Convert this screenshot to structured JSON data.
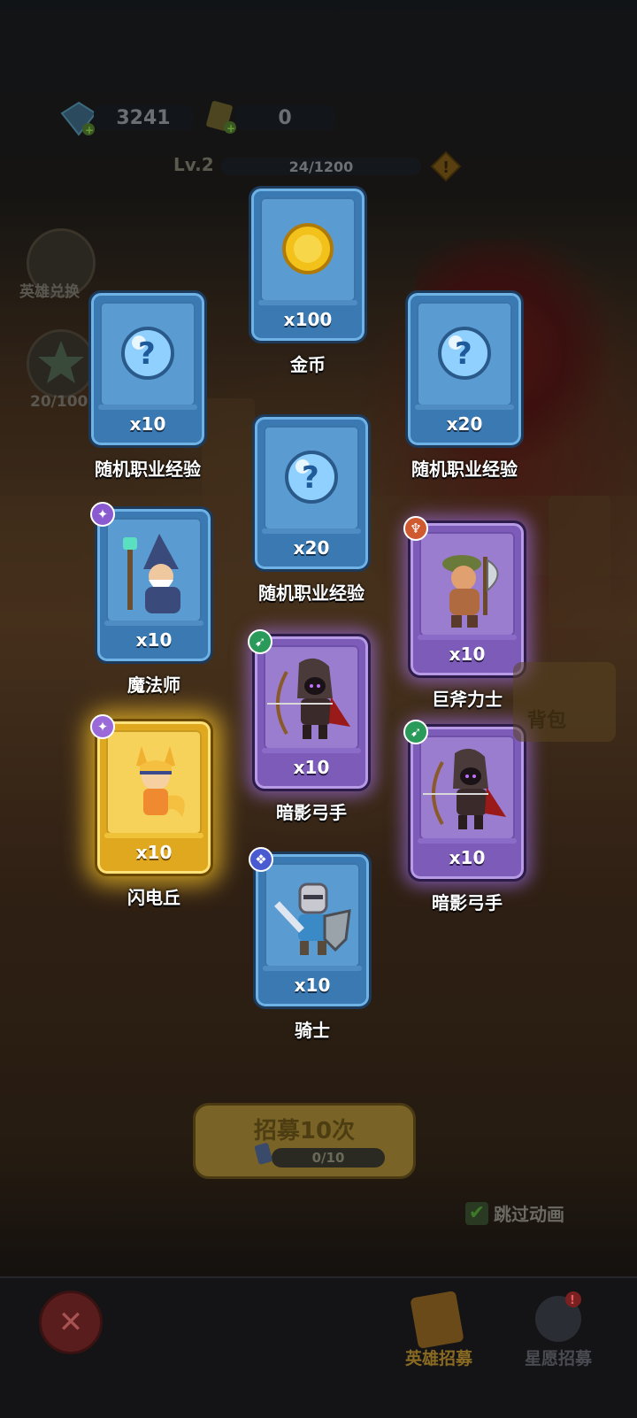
{
  "currency": {
    "gems": "3241",
    "tickets": "0"
  },
  "level": {
    "label": "Lv.2",
    "progress_text": "24/1200",
    "progress_fraction": 0.02
  },
  "side": {
    "exchange_label": "英雄兑换",
    "star_count": "20/100"
  },
  "rewards": [
    {
      "name": "金币",
      "qty": "x100",
      "rarity": "blue",
      "icon": "gold-coin-icon"
    },
    {
      "name": "随机职业经验",
      "qty": "x10",
      "rarity": "blue",
      "icon": "question-orb-icon"
    },
    {
      "name": "随机职业经验",
      "qty": "x20",
      "rarity": "blue",
      "icon": "question-orb-icon"
    },
    {
      "name": "随机职业经验",
      "qty": "x20",
      "rarity": "blue",
      "icon": "question-orb-icon"
    },
    {
      "name": "魔法师",
      "qty": "x10",
      "rarity": "blue",
      "icon": "wizard-hero-icon"
    },
    {
      "name": "巨斧力士",
      "qty": "x10",
      "rarity": "purple",
      "icon": "axe-warrior-hero-icon"
    },
    {
      "name": "暗影弓手",
      "qty": "x10",
      "rarity": "purple",
      "icon": "shadow-archer-hero-icon"
    },
    {
      "name": "闪电丘",
      "qty": "x10",
      "rarity": "gold",
      "icon": "lightning-fox-hero-icon"
    },
    {
      "name": "暗影弓手",
      "qty": "x10",
      "rarity": "purple",
      "icon": "shadow-archer-hero-icon"
    },
    {
      "name": "骑士",
      "qty": "x10",
      "rarity": "blue",
      "icon": "knight-hero-icon"
    }
  ],
  "recruit": {
    "title": "招募10次",
    "progress": "0/10"
  },
  "skip_label": "跳过动画",
  "nav": {
    "hero_recruit": "英雄招募",
    "wish_recruit": "星愿招募"
  },
  "side_bag": "背包",
  "colors": {
    "blue_card": "#3b79b3",
    "purple_card": "#7d5bb8",
    "gold_card": "#e0a81e"
  }
}
